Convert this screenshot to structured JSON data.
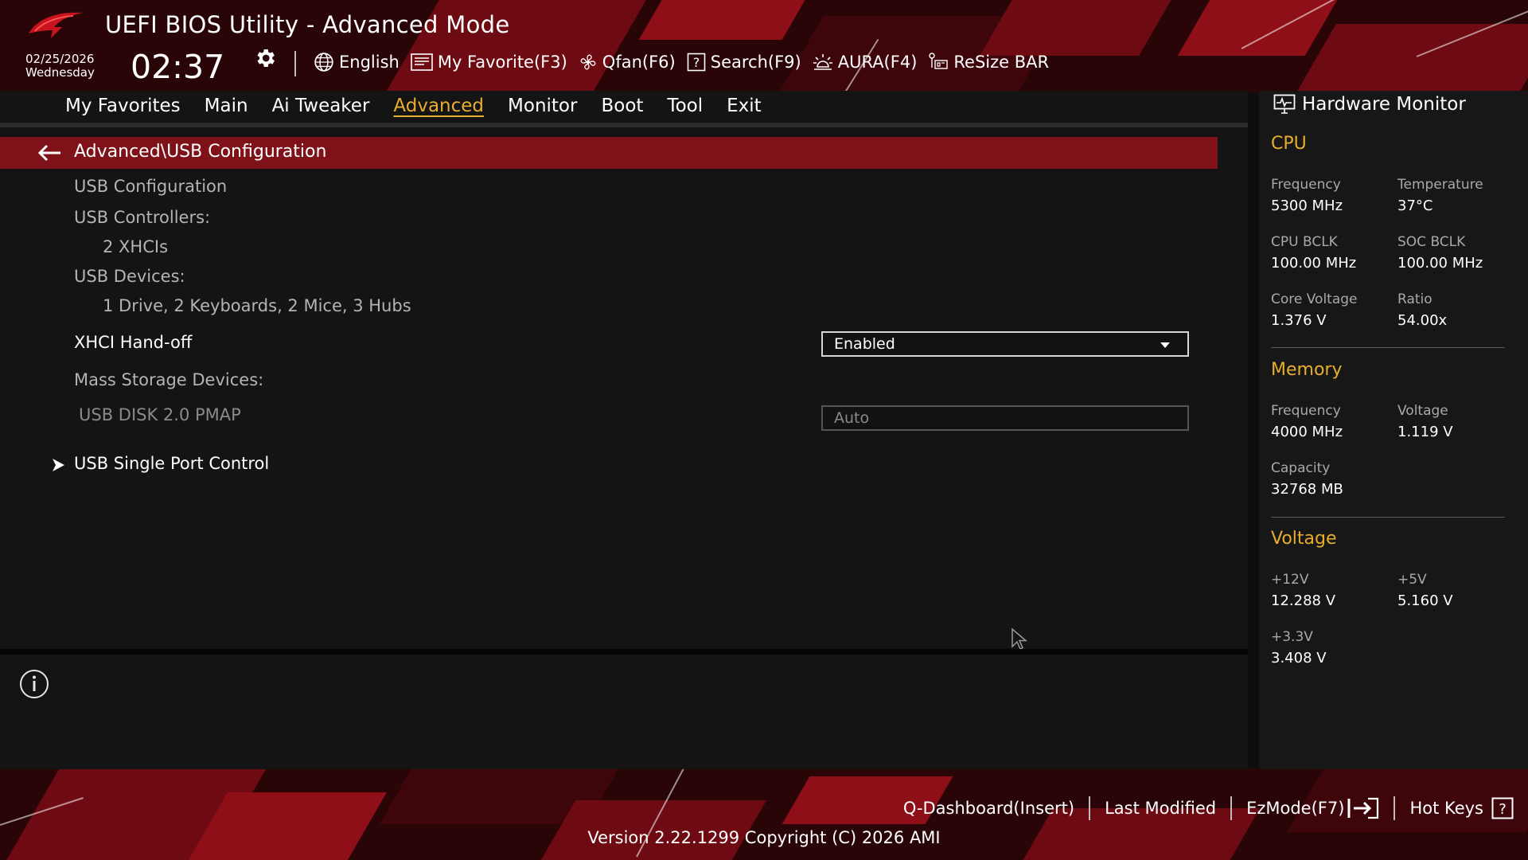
{
  "header": {
    "title": "UEFI BIOS Utility - Advanced Mode",
    "date": "02/25/2026",
    "weekday": "Wednesday",
    "time": "02:37",
    "toolbar": {
      "language": "English",
      "my_favorite": "My Favorite(F3)",
      "qfan": "Qfan(F6)",
      "search": "Search(F9)",
      "aura": "AURA(F4)",
      "resize_bar": "ReSize BAR"
    }
  },
  "menu": {
    "tabs": [
      "My Favorites",
      "Main",
      "Ai Tweaker",
      "Advanced",
      "Monitor",
      "Boot",
      "Tool",
      "Exit"
    ],
    "active": "Advanced"
  },
  "main": {
    "breadcrumb": "Advanced\\USB Configuration",
    "usb_config_label": "USB Configuration",
    "usb_controllers_label": "USB Controllers:",
    "usb_controllers_value": "2 XHCIs",
    "usb_devices_label": "USB Devices:",
    "usb_devices_value": "1 Drive, 2 Keyboards, 2 Mice, 3 Hubs",
    "xhci_handoff_label": "XHCI Hand-off",
    "xhci_handoff_value": "Enabled",
    "mass_storage_label": "Mass Storage Devices:",
    "usb_disk_label": "USB DISK 2.0 PMAP",
    "usb_disk_value": "Auto",
    "single_port_label": "USB Single Port Control"
  },
  "hardware_monitor": {
    "title": "Hardware Monitor",
    "cpu": {
      "heading": "CPU",
      "frequency_label": "Frequency",
      "frequency_value": "5300 MHz",
      "temperature_label": "Temperature",
      "temperature_value": "37°C",
      "cpu_bclk_label": "CPU BCLK",
      "cpu_bclk_value": "100.00 MHz",
      "soc_bclk_label": "SOC BCLK",
      "soc_bclk_value": "100.00 MHz",
      "core_voltage_label": "Core Voltage",
      "core_voltage_value": "1.376 V",
      "ratio_label": "Ratio",
      "ratio_value": "54.00x"
    },
    "memory": {
      "heading": "Memory",
      "frequency_label": "Frequency",
      "frequency_value": "4000 MHz",
      "voltage_label": "Voltage",
      "voltage_value": "1.119 V",
      "capacity_label": "Capacity",
      "capacity_value": "32768 MB"
    },
    "voltage": {
      "heading": "Voltage",
      "v12_label": "+12V",
      "v12_value": "12.288 V",
      "v5_label": "+5V",
      "v5_value": "5.160 V",
      "v33_label": "+3.3V",
      "v33_value": "3.408 V"
    }
  },
  "footer": {
    "q_dashboard": "Q-Dashboard(Insert)",
    "last_modified": "Last Modified",
    "ezmode": "EzMode(F7)",
    "hot_keys": "Hot Keys",
    "version": "Version 2.22.1299 Copyright (C) 2026 AMI"
  },
  "colors": {
    "accent": "#e8ad2c",
    "breadcrumb_bg": "#7e1218",
    "background": "#141414"
  },
  "icons": [
    "rog-logo-icon",
    "gear-icon",
    "globe-icon",
    "favorite-list-icon",
    "fan-icon",
    "search-help-icon",
    "aura-light-icon",
    "resize-bar-icon",
    "back-arrow-icon",
    "submenu-arrow-icon",
    "info-icon",
    "monitor-icon",
    "exit-arrow-icon",
    "question-icon",
    "mouse-cursor-icon"
  ]
}
